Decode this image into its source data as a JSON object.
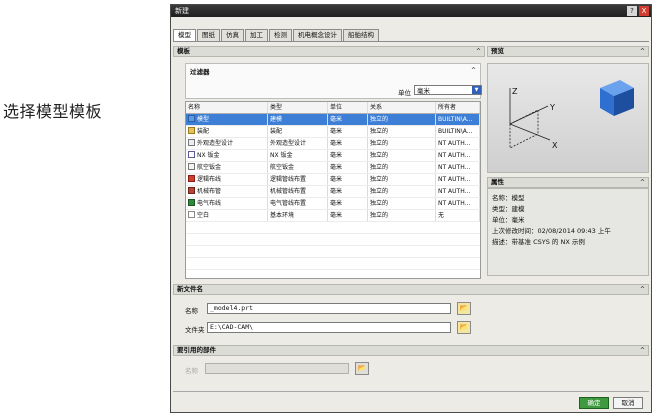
{
  "caption": "选择模型模板",
  "window": {
    "title": "新建",
    "help": "?",
    "close": "X"
  },
  "tabs": [
    "模型",
    "图纸",
    "仿真",
    "加工",
    "检测",
    "机电概念设计",
    "船舶结构"
  ],
  "template_section": {
    "title": "模板",
    "chevron": "^"
  },
  "filter": {
    "title": "过滤器",
    "chevron": "^",
    "unit_label": "单位",
    "unit_value": "毫米",
    "unit_arrow": "▼"
  },
  "table": {
    "columns": [
      "名称",
      "类型",
      "单位",
      "关系",
      "所有者"
    ],
    "rows": [
      [
        "模型",
        "建模",
        "毫米",
        "独立的",
        "BUILTIN\\A..."
      ],
      [
        "装配",
        "装配",
        "毫米",
        "独立的",
        "BUILTIN\\A..."
      ],
      [
        "外观造型设计",
        "外观造型设计",
        "毫米",
        "独立的",
        "NT AUTH..."
      ],
      [
        "NX 钣金",
        "NX 钣金",
        "毫米",
        "独立的",
        "NT AUTH..."
      ],
      [
        "航空钣金",
        "航空钣金",
        "毫米",
        "独立的",
        "NT AUTH..."
      ],
      [
        "逻辑布线",
        "逻辑管线布置",
        "毫米",
        "独立的",
        "NT AUTH..."
      ],
      [
        "机械布管",
        "机械管线布置",
        "毫米",
        "独立的",
        "NT AUTH..."
      ],
      [
        "电气布线",
        "电气管线布置",
        "毫米",
        "独立的",
        "NT AUTH..."
      ],
      [
        "空白",
        "基本环境",
        "毫米",
        "独立的",
        "无"
      ]
    ]
  },
  "preview_section": {
    "title": "预览",
    "chevron": "^"
  },
  "preview": {
    "axis_x": "X",
    "axis_y": "Y",
    "axis_z": "Z"
  },
  "props_section": {
    "title": "属性",
    "chevron": "^"
  },
  "props": [
    "名称：模型",
    "类型：建模",
    "单位：毫米",
    "上次修改时间：02/08/2014 09:43 上午",
    "描述：带基准 CSYS 的 NX 示例"
  ],
  "new_file": {
    "title": "新文件名",
    "chevron": "^",
    "name_label": "名称",
    "name_value": "_model4.prt",
    "folder_label": "文件夹",
    "folder_value": "E:\\CAD-CAM\\",
    "browse": "📂"
  },
  "ref_part": {
    "title": "要引用的部件",
    "chevron": "^",
    "name_label": "名称",
    "browse": "📂"
  },
  "buttons": {
    "ok": "确定",
    "cancel": "取消"
  },
  "colors": {
    "selection": "#3d7fd6",
    "ok": "#3f9a3f",
    "title_bg": "#1f1f1f",
    "cube": "#2f6fd0"
  }
}
